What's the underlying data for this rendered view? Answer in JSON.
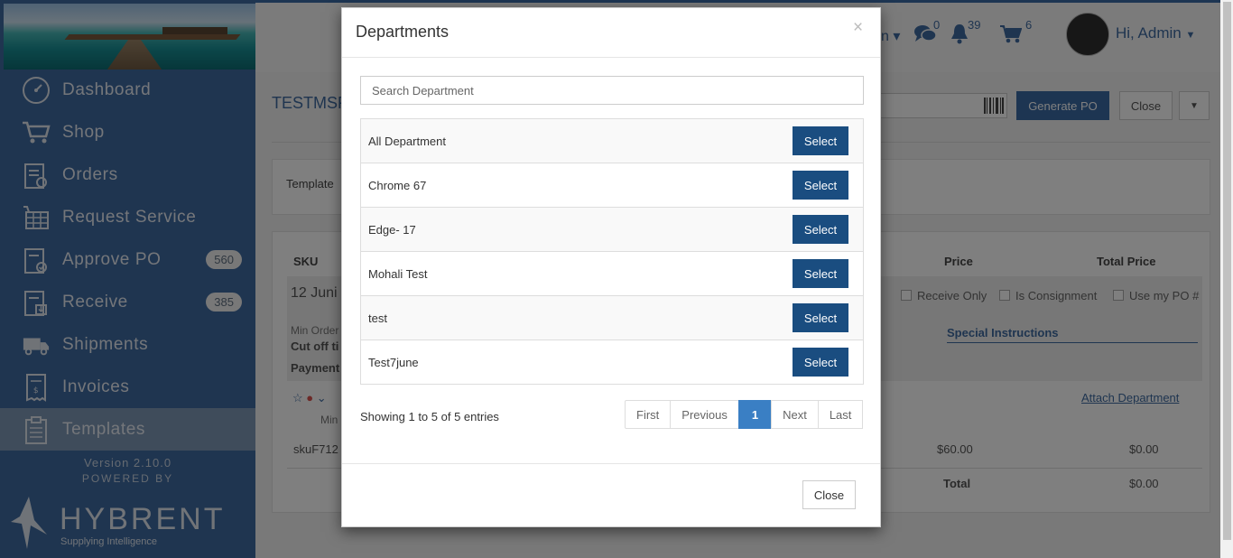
{
  "sidebar": {
    "items": [
      {
        "label": "Dashboard",
        "icon": "dashboard-icon",
        "badge": null
      },
      {
        "label": "Shop",
        "icon": "cart-icon",
        "badge": null
      },
      {
        "label": "Orders",
        "icon": "orders-icon",
        "badge": null
      },
      {
        "label": "Request Service",
        "icon": "request-service-icon",
        "badge": null
      },
      {
        "label": "Approve PO",
        "icon": "approve-icon",
        "badge": "560"
      },
      {
        "label": "Receive",
        "icon": "receive-icon",
        "badge": "385"
      },
      {
        "label": "Shipments",
        "icon": "truck-icon",
        "badge": null
      },
      {
        "label": "Invoices",
        "icon": "invoice-icon",
        "badge": null
      },
      {
        "label": "Templates",
        "icon": "templates-icon",
        "badge": null
      }
    ],
    "active": "Templates",
    "version": "Version 2.10.0",
    "powered_by": "POWERED BY",
    "logo_word": "HYBRENT",
    "logo_tagline": "Supplying Intelligence"
  },
  "header": {
    "messages_count": "0",
    "notifications_count": "39",
    "cart_count": "6",
    "greeting": "Hi, Admin"
  },
  "page": {
    "title_partial": "TESTMSF",
    "generate_po_label": "Generate PO",
    "close_label": "Close",
    "template_label": "Template",
    "col_sku": "SKU",
    "col_price": "Price",
    "col_total_price": "Total Price",
    "date_partial": "12 Juni",
    "min_order_partial": "Min Order",
    "cutoff_partial": "Cut off ti",
    "payment_partial": "Payment",
    "receive_only": "Receive Only",
    "is_consignment": "Is Consignment",
    "use_my_po": "Use my PO #",
    "special_instructions": "Special Instructions",
    "attach_department": "Attach Department",
    "row_min_partial": "Min",
    "sku_partial": "skuF712",
    "price_value": "$60.00",
    "total_price_value": "$0.00",
    "total_label": "Total",
    "total_value": "$0.00"
  },
  "modal": {
    "title": "Departments",
    "search_placeholder": "Search Department",
    "departments": [
      {
        "name": "All Department",
        "action": "Select"
      },
      {
        "name": "Chrome 67",
        "action": "Select"
      },
      {
        "name": "Edge- 17",
        "action": "Select"
      },
      {
        "name": "Mohali Test",
        "action": "Select"
      },
      {
        "name": "test",
        "action": "Select"
      },
      {
        "name": "Test7june",
        "action": "Select"
      }
    ],
    "showing_text": "Showing 1 to 5 of 5 entries",
    "pagination": {
      "first": "First",
      "previous": "Previous",
      "current": "1",
      "next": "Next",
      "last": "Last"
    },
    "close_label": "Close"
  },
  "colors": {
    "brand": "#3e6aa1",
    "select_button": "#1a4d80",
    "pager_current": "#3a7fc4"
  }
}
